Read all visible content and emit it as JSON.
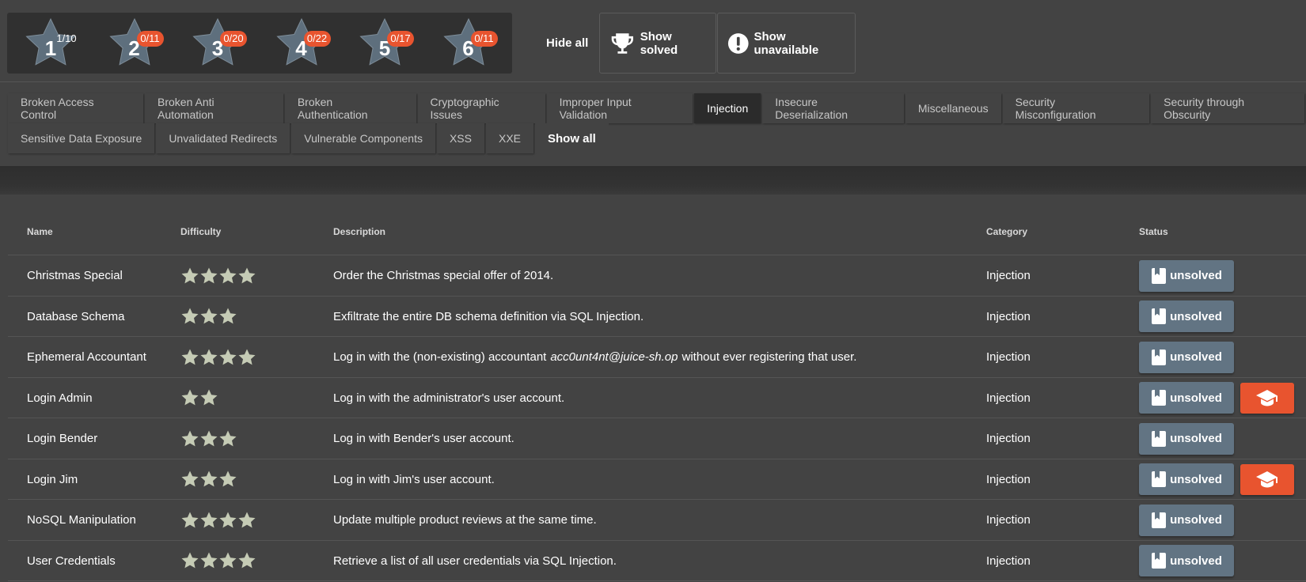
{
  "difficulty_filters": [
    {
      "level": "1",
      "progress": "1/10",
      "highlighted": false
    },
    {
      "level": "2",
      "progress": "0/11",
      "highlighted": true
    },
    {
      "level": "3",
      "progress": "0/20",
      "highlighted": true
    },
    {
      "level": "4",
      "progress": "0/22",
      "highlighted": true
    },
    {
      "level": "5",
      "progress": "0/17",
      "highlighted": true
    },
    {
      "level": "6",
      "progress": "0/11",
      "highlighted": true
    }
  ],
  "toolbar": {
    "hide_all": "Hide all",
    "show_solved": "Show solved",
    "show_unavailable": "Show unavailable"
  },
  "categories": {
    "row1": [
      "Broken Access Control",
      "Broken Anti Automation",
      "Broken Authentication",
      "Cryptographic Issues",
      "Improper Input Validation",
      "Injection",
      "Insecure Deserialization",
      "Miscellaneous",
      "Security Misconfiguration",
      "Security through Obscurity"
    ],
    "row2": [
      "Sensitive Data Exposure",
      "Unvalidated Redirects",
      "Vulnerable Components",
      "XSS",
      "XXE"
    ],
    "active": "Injection",
    "show_all": "Show all"
  },
  "table": {
    "headers": {
      "name": "Name",
      "difficulty": "Difficulty",
      "description": "Description",
      "category": "Category",
      "status": "Status"
    },
    "rows": [
      {
        "name": "Christmas Special",
        "stars": 4,
        "desc": "Order the Christmas special offer of 2014.",
        "desc_em": "",
        "desc_after": "",
        "category": "Injection",
        "status": "unsolved",
        "hint": false
      },
      {
        "name": "Database Schema",
        "stars": 3,
        "desc": "Exfiltrate the entire DB schema definition via SQL Injection.",
        "desc_em": "",
        "desc_after": "",
        "category": "Injection",
        "status": "unsolved",
        "hint": false
      },
      {
        "name": "Ephemeral Accountant",
        "stars": 4,
        "desc": "Log in with the (non-existing) accountant",
        "desc_em": "acc0unt4nt@juice-sh.op",
        "desc_after": "without ever registering that user.",
        "category": "Injection",
        "status": "unsolved",
        "hint": false
      },
      {
        "name": "Login Admin",
        "stars": 2,
        "desc": "Log in with the administrator's user account.",
        "desc_em": "",
        "desc_after": "",
        "category": "Injection",
        "status": "unsolved",
        "hint": true
      },
      {
        "name": "Login Bender",
        "stars": 3,
        "desc": "Log in with Bender's user account.",
        "desc_em": "",
        "desc_after": "",
        "category": "Injection",
        "status": "unsolved",
        "hint": false
      },
      {
        "name": "Login Jim",
        "stars": 3,
        "desc": "Log in with Jim's user account.",
        "desc_em": "",
        "desc_after": "",
        "category": "Injection",
        "status": "unsolved",
        "hint": true
      },
      {
        "name": "NoSQL Manipulation",
        "stars": 4,
        "desc": "Update multiple product reviews at the same time.",
        "desc_em": "",
        "desc_after": "",
        "category": "Injection",
        "status": "unsolved",
        "hint": false
      },
      {
        "name": "User Credentials",
        "stars": 4,
        "desc": "Retrieve a list of all user credentials via SQL Injection.",
        "desc_em": "",
        "desc_after": "",
        "category": "Injection",
        "status": "unsolved",
        "hint": false
      }
    ]
  },
  "colors": {
    "background": "#434343",
    "badge": "#e8542f",
    "status_button": "#627483",
    "hint_button": "#e8542f",
    "difficulty_star": "#c5cbb5",
    "filter_star": "#5e6f7d"
  },
  "icons": {
    "show_solved": "trophy-icon",
    "show_unavailable": "exclamation-circle-icon",
    "status": "bookmark-icon",
    "hint": "graduation-cap-icon"
  }
}
